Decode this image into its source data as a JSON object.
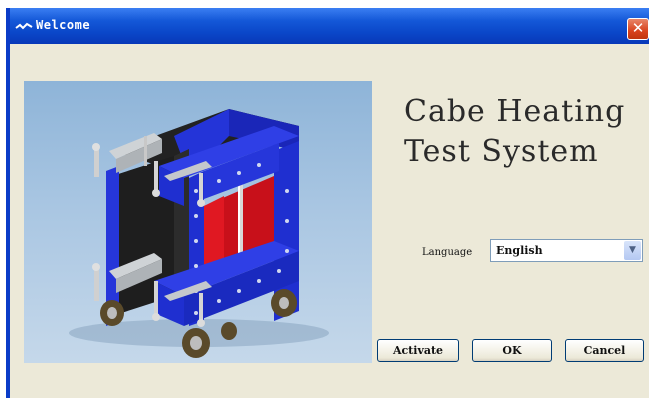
{
  "window": {
    "title": "Welcome",
    "close_glyph": "✕"
  },
  "main": {
    "title_line1": "Cabe Heating",
    "title_line2": "Test System",
    "language_label": "Language",
    "language_value": "English",
    "dropdown_glyph": "▼"
  },
  "buttons": {
    "activate": "Activate",
    "ok": "OK",
    "cancel": "Cancel"
  },
  "image": {
    "subject": "test-rig-3d-model"
  },
  "colors": {
    "titlebar": "#0a46c8",
    "window_bg": "#ece9d8",
    "close_button": "#d8431e",
    "frame_blue": "#1f2fd0",
    "heater_red": "#c8101a"
  }
}
